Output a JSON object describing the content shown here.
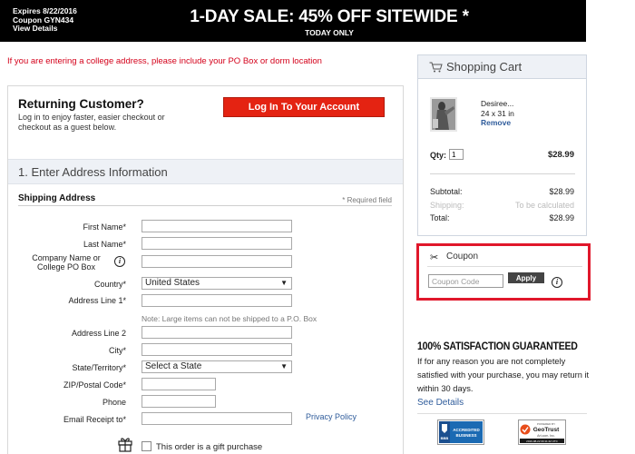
{
  "banner": {
    "expires": "Expires 8/22/2016",
    "coupon": "Coupon GYN434",
    "view_details": "View Details",
    "title": "1-DAY SALE: 45% OFF SITEWIDE *",
    "subtitle": "TODAY ONLY"
  },
  "college_note": "If you are entering a college address, please include your PO Box or dorm location",
  "returning": {
    "title": "Returning Customer?",
    "text": "Log in to enjoy faster, easier checkout or checkout as a guest below.",
    "login_label": "Log In To Your Account"
  },
  "address_section": {
    "title": "1. Enter Address Information",
    "shipping_heading": "Shipping Address",
    "required_note": "* Required field",
    "fields": {
      "first_name": "First Name*",
      "last_name": "Last Name*",
      "company": "Company Name or College PO Box",
      "country": "Country*",
      "country_value": "United States",
      "address1": "Address Line 1*",
      "po_note": "Note: Large items can not be shipped to a P.O. Box",
      "address2": "Address Line 2",
      "city": "City*",
      "state": "State/Territory*",
      "state_value": "Select a State",
      "zip": "ZIP/Postal Code*",
      "phone": "Phone",
      "email": "Email Receipt to*"
    },
    "privacy_link": "Privacy Policy",
    "gift_label": "This order is a gift purchase"
  },
  "cart": {
    "title": "Shopping Cart",
    "item_name": "Desiree...",
    "item_size": "24 x 31 in",
    "remove_label": "Remove",
    "qty_label": "Qty:",
    "qty_value": "1",
    "item_price": "$28.99",
    "subtotal_label": "Subtotal:",
    "subtotal_value": "$28.99",
    "shipping_label": "Shipping:",
    "shipping_value": "To be calculated",
    "total_label": "Total:",
    "total_value": "$28.99"
  },
  "coupon": {
    "title": "Coupon",
    "placeholder": "Coupon Code",
    "apply_label": "Apply"
  },
  "guarantee": {
    "title": "100% SATISFACTION GUARANTEED",
    "text": "If for any reason you are not completely satisfied with your purchase, you may return it within 30 days.",
    "see_details": "See Details"
  },
  "badges": {
    "bbb_line1": "ACCREDITED",
    "bbb_line2": "BUSINESS",
    "bbb_mark": "BBB",
    "geotrust_top": "POWERED BY",
    "geotrust_name": "GeoTrust",
    "geotrust_site": "Art.com, Inc.",
    "geotrust_date": "2016-08-22 09:11:42 UTC"
  },
  "colors": {
    "accent_red": "#e42312",
    "coupon_border": "#e0172b",
    "link_blue": "#2f5c9b",
    "panel_header": "#eef1f6"
  }
}
